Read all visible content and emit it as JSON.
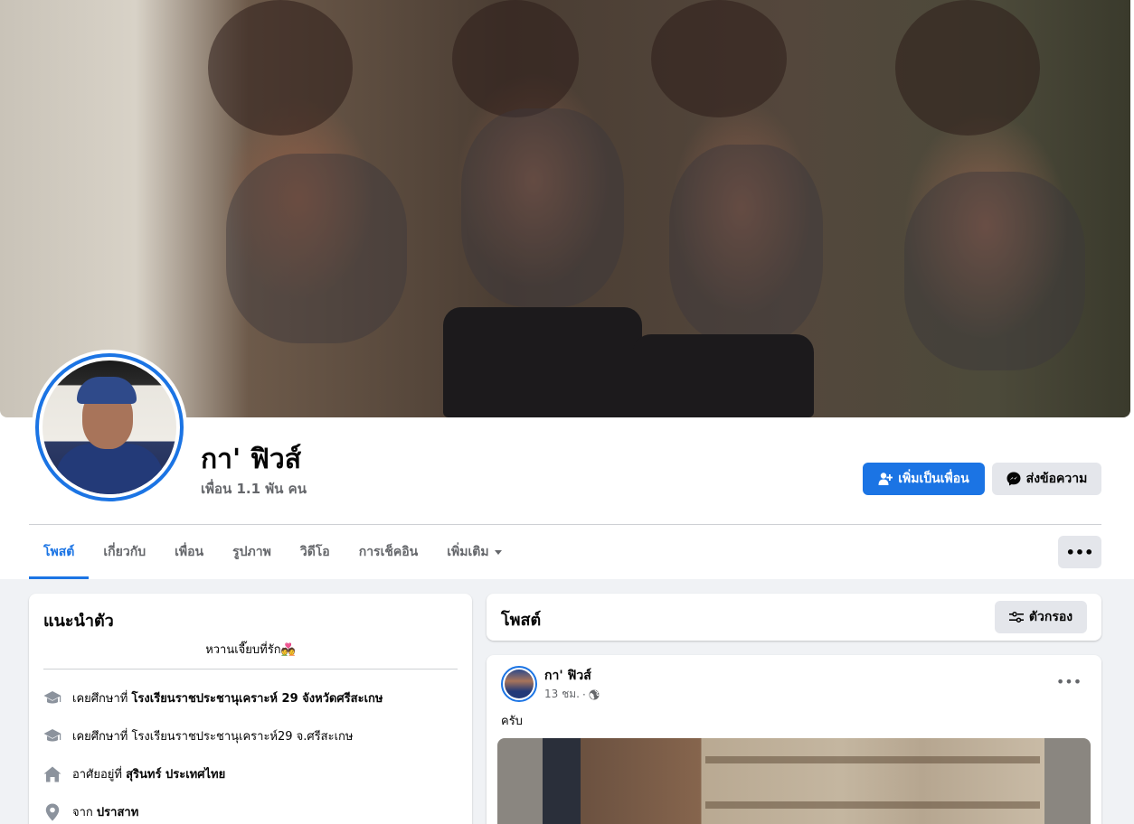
{
  "profile": {
    "name": "กา' ฟิวส์",
    "friends": "เพื่อน 1.1 พัน คน"
  },
  "actions": {
    "add_friend": "เพิ่มเป็นเพื่อน",
    "message": "ส่งข้อความ",
    "more": "•••"
  },
  "tabs": [
    {
      "label": "โพสต์",
      "active": true
    },
    {
      "label": "เกี่ยวกับ"
    },
    {
      "label": "เพื่อน"
    },
    {
      "label": "รูปภาพ"
    },
    {
      "label": "วิดีโอ"
    },
    {
      "label": "การเช็คอิน"
    },
    {
      "label": "เพิ่มเติม"
    }
  ],
  "intro": {
    "title": "แนะนำตัว",
    "bio": "หวานเจี๊ยบที่รัก💑",
    "rows": [
      {
        "icon": "graduation-cap-icon",
        "prefix": "เคยศึกษาที่ ",
        "value": "โรงเรียนราชประชานุเคราะห์ 29 จังหวัดศรีสะเกษ",
        "bold": true
      },
      {
        "icon": "graduation-cap-icon",
        "prefix": "เคยศึกษาที่ ",
        "value": "โรงเรียนราชประชานุเคราะห์29 จ.ศรีสะเกษ",
        "bold": false
      },
      {
        "icon": "home-icon",
        "prefix": "อาศัยอยู่ที่ ",
        "value": "สุรินทร์ ประเทศไทย",
        "bold": true
      },
      {
        "icon": "location-pin-icon",
        "prefix": "จาก ",
        "value": "ปราสาท",
        "bold": true
      }
    ]
  },
  "posts_header": {
    "title": "โพสต์",
    "filter": "ตัวกรอง"
  },
  "post": {
    "author": "กา' ฟิวส์",
    "time": "13 ชม.",
    "separator": "·",
    "text": "ครับ",
    "menu": "•••"
  },
  "colors": {
    "accent": "#1b74e4",
    "secondary_button": "#e4e6eb",
    "page_bg": "#f0f2f5",
    "muted_text": "#65676b"
  }
}
